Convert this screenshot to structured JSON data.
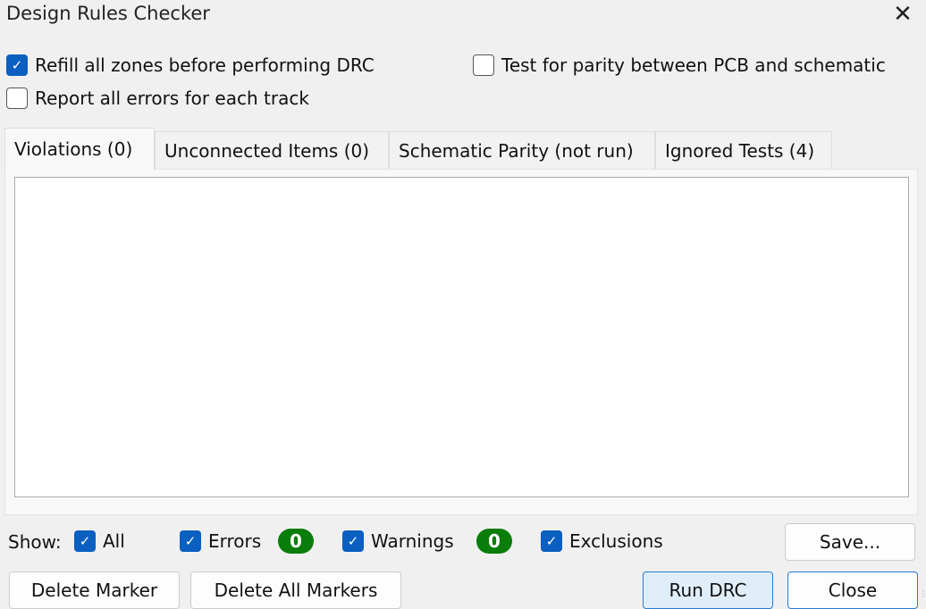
{
  "window": {
    "title": "Design Rules Checker"
  },
  "options": {
    "refill_zones": {
      "label": "Refill all zones before performing DRC",
      "checked": true
    },
    "report_all_errors": {
      "label": "Report all errors for each track",
      "checked": false
    },
    "test_parity": {
      "label": "Test for parity between PCB and schematic",
      "checked": false
    }
  },
  "tabs": [
    {
      "label": "Violations (0)",
      "active": true
    },
    {
      "label": "Unconnected Items (0)"
    },
    {
      "label": "Schematic Parity (not run)"
    },
    {
      "label": "Ignored Tests (4)"
    }
  ],
  "filters": {
    "show_label": "Show:",
    "all": "All",
    "errors": "Errors",
    "errors_count": "0",
    "warnings": "Warnings",
    "warnings_count": "0",
    "exclusions": "Exclusions",
    "badge_color": "#0a7d0a",
    "check_color": "#0a5fc0"
  },
  "buttons": {
    "save": "Save...",
    "delete_marker": "Delete Marker",
    "delete_all_markers": "Delete All Markers",
    "run_drc": "Run DRC",
    "close": "Close"
  }
}
